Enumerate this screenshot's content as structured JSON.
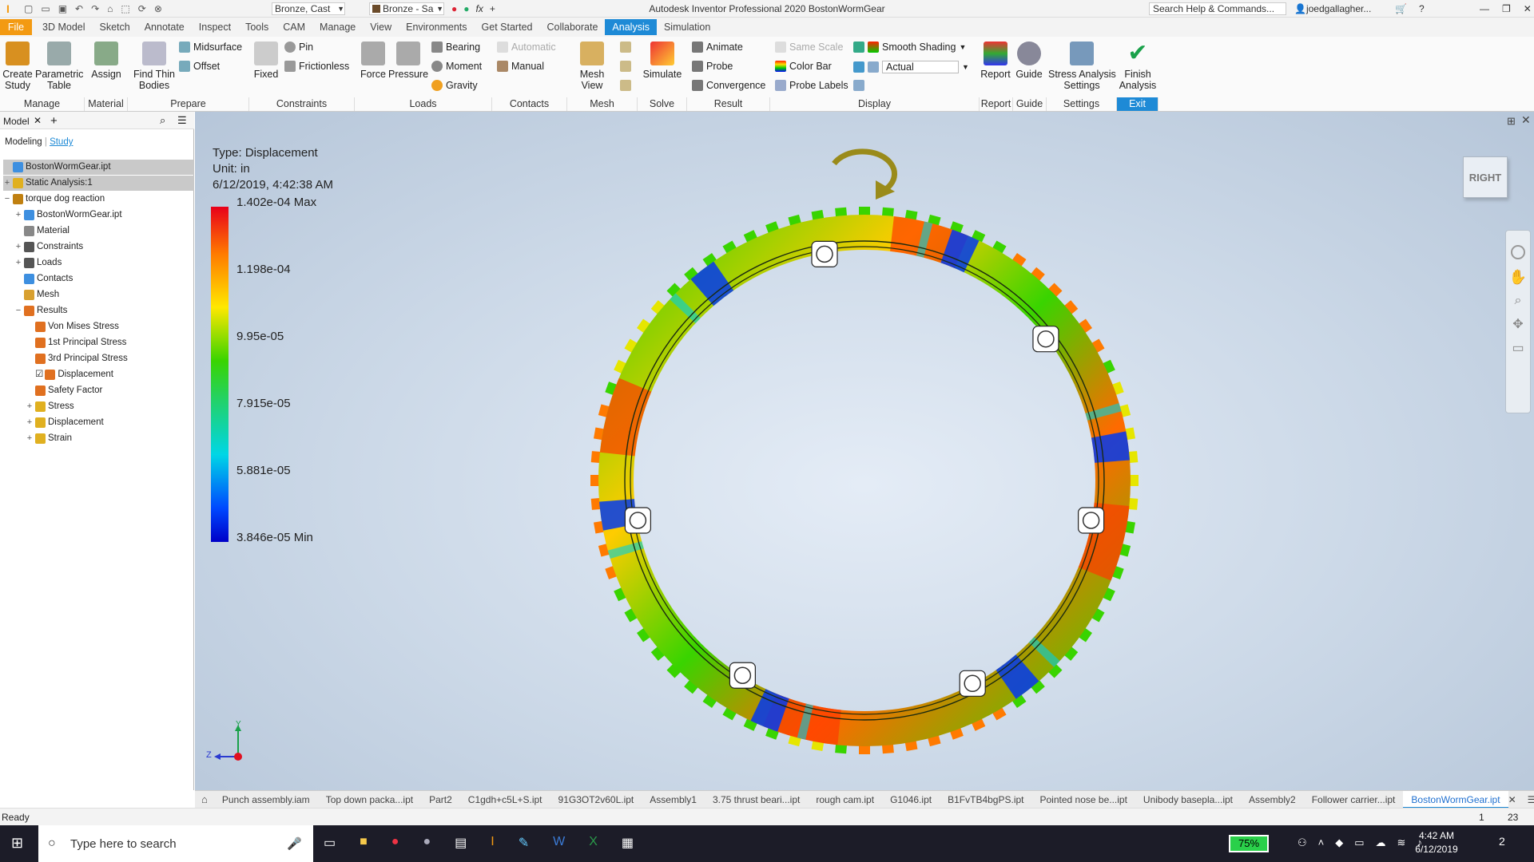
{
  "title_bar": {
    "title": "Autodesk Inventor Professional 2020 BostonWormGear",
    "material": "Bronze, Cast",
    "appearance": "Bronze - Sa",
    "search_placeholder": "Search Help & Commands...",
    "user": "joedgallagher..."
  },
  "menu_tabs": [
    "File",
    "3D Model",
    "Sketch",
    "Annotate",
    "Inspect",
    "Tools",
    "CAM",
    "Manage",
    "View",
    "Environments",
    "Get Started",
    "Collaborate",
    "Analysis",
    "Simulation"
  ],
  "active_tab": "Analysis",
  "ribbon": {
    "manage": {
      "create_study": "Create\nStudy",
      "parametric_table": "Parametric\nTable",
      "group": "Manage"
    },
    "material": {
      "assign": "Assign",
      "group": "Material"
    },
    "prepare": {
      "find_thin": "Find Thin\nBodies",
      "midsurface": "Midsurface",
      "offset": "Offset",
      "group": "Prepare"
    },
    "constraints": {
      "fixed": "Fixed",
      "pin": "Pin",
      "frictionless": "Frictionless",
      "group": "Constraints"
    },
    "loads": {
      "force": "Force",
      "pressure": "Pressure",
      "bearing": "Bearing",
      "moment": "Moment",
      "gravity": "Gravity",
      "group": "Loads"
    },
    "contacts": {
      "automatic": "Automatic",
      "manual": "Manual",
      "group": "Contacts"
    },
    "mesh": {
      "mesh_view": "Mesh View",
      "group": "Mesh"
    },
    "solve": {
      "simulate": "Simulate",
      "group": "Solve"
    },
    "result": {
      "animate": "Animate",
      "probe": "Probe",
      "convergence": "Convergence",
      "group": "Result"
    },
    "display": {
      "same_scale": "Same Scale",
      "color_bar": "Color Bar",
      "probe_labels": "Probe Labels",
      "shading": "Smooth Shading",
      "scale": "Actual",
      "group": "Display"
    },
    "report": {
      "report": "Report",
      "group": "Report"
    },
    "guide": {
      "guide": "Guide",
      "group": "Guide"
    },
    "settings": {
      "stress_settings": "Stress Analysis\nSettings",
      "group": "Settings"
    },
    "exit": {
      "finish": "Finish\nAnalysis",
      "group": "Exit"
    }
  },
  "browser": {
    "tab_model": "Model",
    "sub_modeling": "Modeling",
    "sub_study": "Study",
    "items": [
      {
        "label": "BostonWormGear.ipt",
        "indent": 0,
        "pm": "",
        "icon": "part-icon",
        "color": "#3d8fe0",
        "selected": true
      },
      {
        "label": "Static Analysis:1",
        "indent": 0,
        "pm": "+",
        "icon": "analysis-icon",
        "color": "#e0b020",
        "selected": true
      },
      {
        "label": "torque dog reaction",
        "indent": 0,
        "pm": "−",
        "icon": "study-icon",
        "color": "#c08010"
      },
      {
        "label": "BostonWormGear.ipt",
        "indent": 1,
        "pm": "+",
        "icon": "part-icon",
        "color": "#3d8fe0"
      },
      {
        "label": "Material",
        "indent": 1,
        "pm": "",
        "icon": "material-icon",
        "color": "#888"
      },
      {
        "label": "Constraints",
        "indent": 1,
        "pm": "+",
        "icon": "constraint-icon",
        "color": "#555"
      },
      {
        "label": "Loads",
        "indent": 1,
        "pm": "+",
        "icon": "load-icon",
        "color": "#555"
      },
      {
        "label": "Contacts",
        "indent": 1,
        "pm": "",
        "icon": "contact-icon",
        "color": "#3d8fe0"
      },
      {
        "label": "Mesh",
        "indent": 1,
        "pm": "",
        "icon": "mesh-icon",
        "color": "#d8a030"
      },
      {
        "label": "Results",
        "indent": 1,
        "pm": "−",
        "icon": "results-icon",
        "color": "#e07020"
      },
      {
        "label": "Von Mises Stress",
        "indent": 2,
        "pm": "",
        "icon": "result-icon",
        "color": "#e07020"
      },
      {
        "label": "1st Principal Stress",
        "indent": 2,
        "pm": "",
        "icon": "result-icon",
        "color": "#e07020"
      },
      {
        "label": "3rd Principal Stress",
        "indent": 2,
        "pm": "",
        "icon": "result-icon",
        "color": "#e07020"
      },
      {
        "label": "Displacement",
        "indent": 2,
        "pm": "",
        "icon": "result-icon",
        "color": "#e07020",
        "checked": true
      },
      {
        "label": "Safety Factor",
        "indent": 2,
        "pm": "",
        "icon": "result-icon",
        "color": "#e07020"
      },
      {
        "label": "Stress",
        "indent": 2,
        "pm": "+",
        "icon": "folder-icon",
        "color": "#e0b020"
      },
      {
        "label": "Displacement",
        "indent": 2,
        "pm": "+",
        "icon": "folder-icon",
        "color": "#e0b020"
      },
      {
        "label": "Strain",
        "indent": 2,
        "pm": "+",
        "icon": "folder-icon",
        "color": "#e0b020"
      }
    ]
  },
  "legend": {
    "type": "Type: Displacement",
    "unit": "Unit: in",
    "timestamp": "6/12/2019, 4:42:38 AM",
    "labels": [
      "1.402e-04 Max",
      "1.198e-04",
      "9.95e-05",
      "7.915e-05",
      "5.881e-05",
      "3.846e-05 Min"
    ]
  },
  "viewcube": "RIGHT",
  "triad": {
    "y": "Y",
    "z": "Z"
  },
  "doc_tabs": [
    "Punch assembly.iam",
    "Top down packa...ipt",
    "Part2",
    "C1gdh+c5L+S.ipt",
    "91G3OT2v60L.ipt",
    "Assembly1",
    "3.75 thrust beari...ipt",
    "rough cam.ipt",
    "G1046.ipt",
    "B1FvTB4bgPS.ipt",
    "Pointed nose be...ipt",
    "Unibody basepla...ipt",
    "Assembly2",
    "Follower carrier...ipt",
    "BostonWormGear.ipt"
  ],
  "active_doc": "BostonWormGear.ipt",
  "status": {
    "text": "Ready",
    "page": "1",
    "count": "23"
  },
  "taskbar": {
    "search": "Type here to search",
    "battery": "75%",
    "time": "4:42 AM",
    "date": "6/12/2019",
    "notifications": "2"
  }
}
